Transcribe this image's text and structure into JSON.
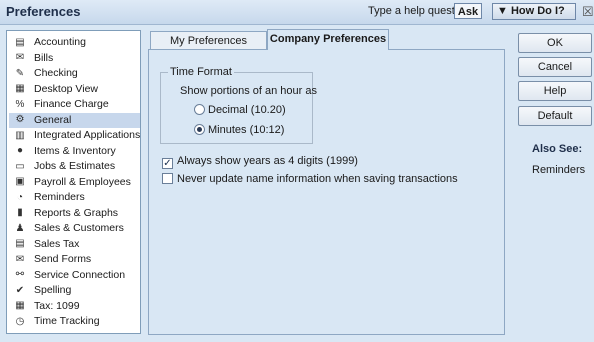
{
  "window": {
    "title": "Preferences",
    "help_prompt": "Type a help question",
    "ask_button": "Ask",
    "how_do_i_button": "How Do I?"
  },
  "sidebar": {
    "items": [
      {
        "label": "Accounting",
        "icon": "accounting-icon"
      },
      {
        "label": "Bills",
        "icon": "bills-icon"
      },
      {
        "label": "Checking",
        "icon": "checking-icon"
      },
      {
        "label": "Desktop View",
        "icon": "desktop-view-icon"
      },
      {
        "label": "Finance Charge",
        "icon": "finance-charge-icon"
      },
      {
        "label": "General",
        "icon": "general-icon"
      },
      {
        "label": "Integrated Applications",
        "icon": "integrated-apps-icon"
      },
      {
        "label": "Items & Inventory",
        "icon": "items-inventory-icon"
      },
      {
        "label": "Jobs & Estimates",
        "icon": "jobs-estimates-icon"
      },
      {
        "label": "Payroll & Employees",
        "icon": "payroll-icon"
      },
      {
        "label": "Reminders",
        "icon": "reminders-icon"
      },
      {
        "label": "Reports & Graphs",
        "icon": "reports-graphs-icon"
      },
      {
        "label": "Sales & Customers",
        "icon": "sales-customers-icon"
      },
      {
        "label": "Sales Tax",
        "icon": "sales-tax-icon"
      },
      {
        "label": "Send Forms",
        "icon": "send-forms-icon"
      },
      {
        "label": "Service Connection",
        "icon": "service-connection-icon"
      },
      {
        "label": "Spelling",
        "icon": "spelling-icon"
      },
      {
        "label": "Tax: 1099",
        "icon": "tax-1099-icon"
      },
      {
        "label": "Time Tracking",
        "icon": "time-tracking-icon"
      }
    ],
    "selected": "General"
  },
  "tabs": {
    "my_preferences": "My Preferences",
    "company_preferences": "Company Preferences",
    "active": "Company Preferences"
  },
  "time_format": {
    "title": "Time Format",
    "description": "Show portions of an hour as",
    "decimal_label": "Decimal (10.20)",
    "minutes_label": "Minutes (10:12)",
    "selected": "Minutes (10:12)"
  },
  "options": {
    "four_digit_years_label": "Always show years as 4 digits (1999)",
    "four_digit_years_checked": true,
    "never_update_label": "Never update name information when saving transactions",
    "never_update_checked": false
  },
  "buttons": {
    "ok": "OK",
    "cancel": "Cancel",
    "help": "Help",
    "default": "Default"
  },
  "also_see": {
    "heading": "Also See:",
    "links": [
      "Reminders"
    ]
  }
}
